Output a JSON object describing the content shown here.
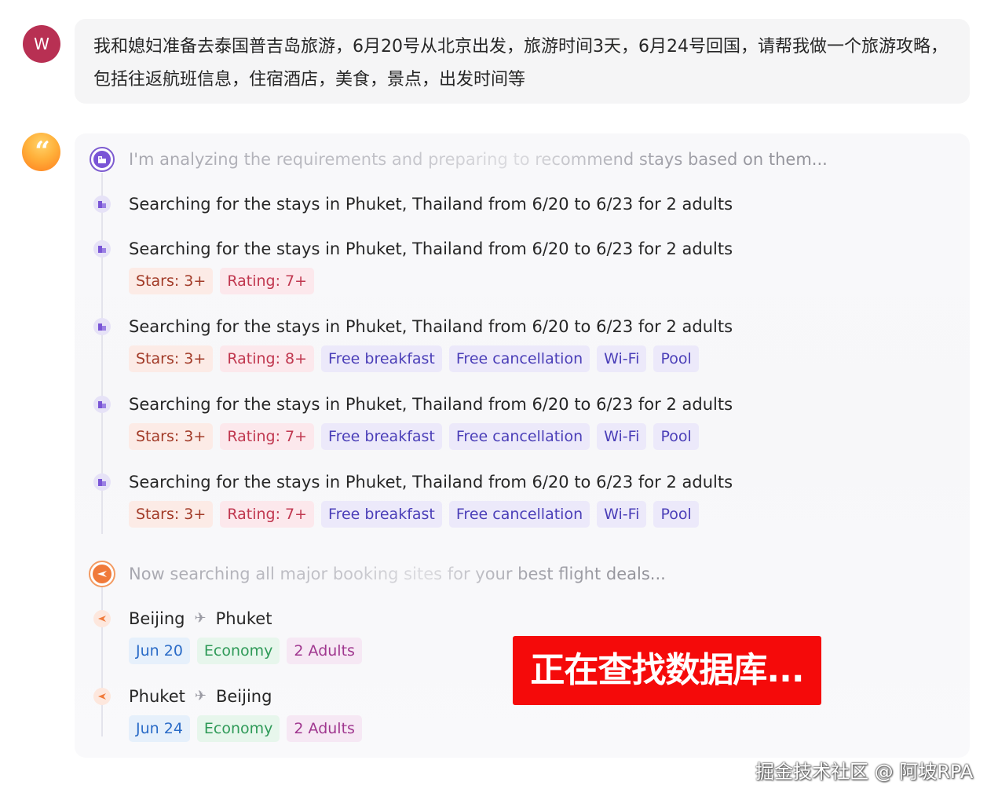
{
  "user": {
    "avatar_initial": "W",
    "message": "我和媳妇准备去泰国普吉岛旅游，6月20号从北京出发，旅游时间3天，6月24号回国，请帮我做一个旅游攻略，包括往返航班信息，住宿酒店，美食，景点，出发时间等"
  },
  "assistant": {
    "avatar_glyph": "“",
    "hotel_status": "I'm analyzing the requirements and preparing to recommend stays based on them...",
    "hotel_searches": [
      {
        "text": "Searching for the stays in Phuket, Thailand from 6/20 to 6/23 for 2 adults",
        "tags": []
      },
      {
        "text": "Searching for the stays in Phuket, Thailand from 6/20 to 6/23 for 2 adults",
        "tags": [
          "Stars: 3+",
          "Rating: 7+"
        ]
      },
      {
        "text": "Searching for the stays in Phuket, Thailand from 6/20 to 6/23 for 2 adults",
        "tags": [
          "Stars: 3+",
          "Rating: 8+",
          "Free breakfast",
          "Free cancellation",
          "Wi-Fi",
          "Pool"
        ]
      },
      {
        "text": "Searching for the stays in Phuket, Thailand from 6/20 to 6/23 for 2 adults",
        "tags": [
          "Stars: 3+",
          "Rating: 7+",
          "Free breakfast",
          "Free cancellation",
          "Wi-Fi",
          "Pool"
        ]
      },
      {
        "text": "Searching for the stays in Phuket, Thailand from 6/20 to 6/23 for 2 adults",
        "tags": [
          "Stars: 3+",
          "Rating: 7+",
          "Free breakfast",
          "Free cancellation",
          "Wi-Fi",
          "Pool"
        ]
      }
    ],
    "flight_status": "Now searching all major booking sites for your best flight deals...",
    "flights": [
      {
        "from": "Beijing",
        "to": "Phuket",
        "date": "Jun 20",
        "cabin": "Economy",
        "passengers": "2 Adults"
      },
      {
        "from": "Phuket",
        "to": "Beijing",
        "date": "Jun 24",
        "cabin": "Economy",
        "passengers": "2 Adults"
      }
    ]
  },
  "overlay": {
    "banner": "正在查找数据库...",
    "watermark": "掘金技术社区 @ 阿坡RPA"
  },
  "colors": {
    "user_avatar": "#b83053",
    "banner": "#f50a0a",
    "hotel_accent": "#7a55d6",
    "flight_accent": "#f07a3a"
  }
}
